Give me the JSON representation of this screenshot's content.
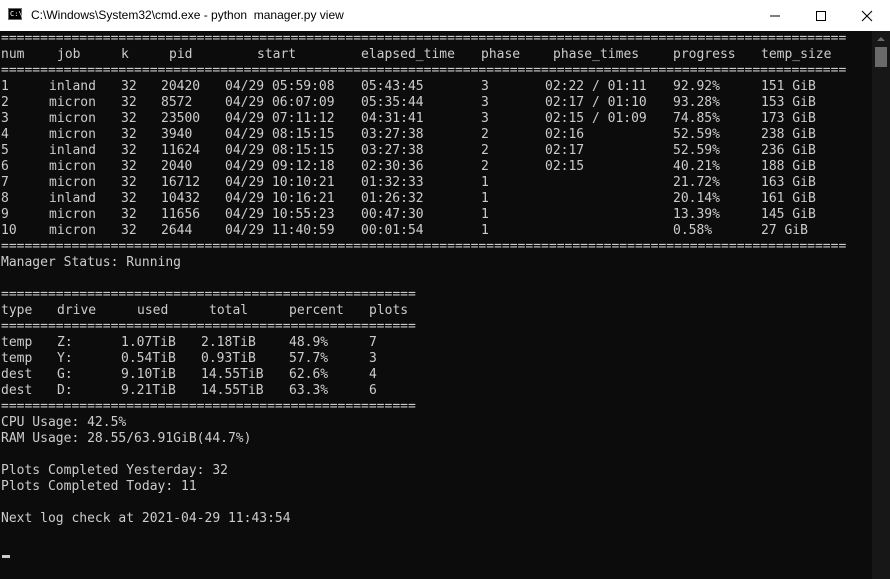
{
  "window": {
    "title": "C:\\Windows\\System32\\cmd.exe - python  manager.py view",
    "icon": "cmd-icon",
    "prompt_glyph": "C:\\"
  },
  "separators": {
    "wide": "============================================================================================================",
    "narrow": "====================================================="
  },
  "jobs": {
    "headers": [
      "num",
      "job",
      "k",
      "pid",
      "start",
      "elapsed_time",
      "phase",
      "phase_times",
      "progress",
      "temp_size"
    ],
    "rows": [
      [
        "1",
        "inland",
        "32",
        "20420",
        "04/29 05:59:08",
        "05:43:45",
        "3",
        "02:22 / 01:11",
        "92.92%",
        "151 GiB"
      ],
      [
        "2",
        "micron",
        "32",
        "8572",
        "04/29 06:07:09",
        "05:35:44",
        "3",
        "02:17 / 01:10",
        "93.28%",
        "153 GiB"
      ],
      [
        "3",
        "micron",
        "32",
        "23500",
        "04/29 07:11:12",
        "04:31:41",
        "3",
        "02:15 / 01:09",
        "74.85%",
        "173 GiB"
      ],
      [
        "4",
        "micron",
        "32",
        "3940",
        "04/29 08:15:15",
        "03:27:38",
        "2",
        "02:16",
        "52.59%",
        "238 GiB"
      ],
      [
        "5",
        "inland",
        "32",
        "11624",
        "04/29 08:15:15",
        "03:27:38",
        "2",
        "02:17",
        "52.59%",
        "236 GiB"
      ],
      [
        "6",
        "micron",
        "32",
        "2040",
        "04/29 09:12:18",
        "02:30:36",
        "2",
        "02:15",
        "40.21%",
        "188 GiB"
      ],
      [
        "7",
        "micron",
        "32",
        "16712",
        "04/29 10:10:21",
        "01:32:33",
        "1",
        "",
        "21.72%",
        "163 GiB"
      ],
      [
        "8",
        "inland",
        "32",
        "10432",
        "04/29 10:16:21",
        "01:26:32",
        "1",
        "",
        "20.14%",
        "161 GiB"
      ],
      [
        "9",
        "micron",
        "32",
        "11656",
        "04/29 10:55:23",
        "00:47:30",
        "1",
        "",
        "13.39%",
        "145 GiB"
      ],
      [
        "10",
        "micron",
        "32",
        "2644",
        "04/29 11:40:59",
        "00:01:54",
        "1",
        "",
        "0.58%",
        "27 GiB"
      ]
    ]
  },
  "manager_status": "Manager Status: Running",
  "drives": {
    "headers": [
      "type",
      "drive",
      "used",
      "total",
      "percent",
      "plots"
    ],
    "rows": [
      [
        "temp",
        "Z:",
        "1.07TiB",
        "2.18TiB",
        "48.9%",
        "7"
      ],
      [
        "temp",
        "Y:",
        "0.54TiB",
        "0.93TiB",
        "57.7%",
        "3"
      ],
      [
        "dest",
        "G:",
        "9.10TiB",
        "14.55TiB",
        "62.6%",
        "4"
      ],
      [
        "dest",
        "D:",
        "9.21TiB",
        "14.55TiB",
        "63.3%",
        "6"
      ]
    ]
  },
  "cpu_usage": "CPU Usage: 42.5%",
  "ram_usage": "RAM Usage: 28.55/63.91GiB(44.7%)",
  "plots_yesterday": "Plots Completed Yesterday: 32",
  "plots_today": "Plots Completed Today: 11",
  "next_log_check": "Next log check at 2021-04-29 11:43:54"
}
